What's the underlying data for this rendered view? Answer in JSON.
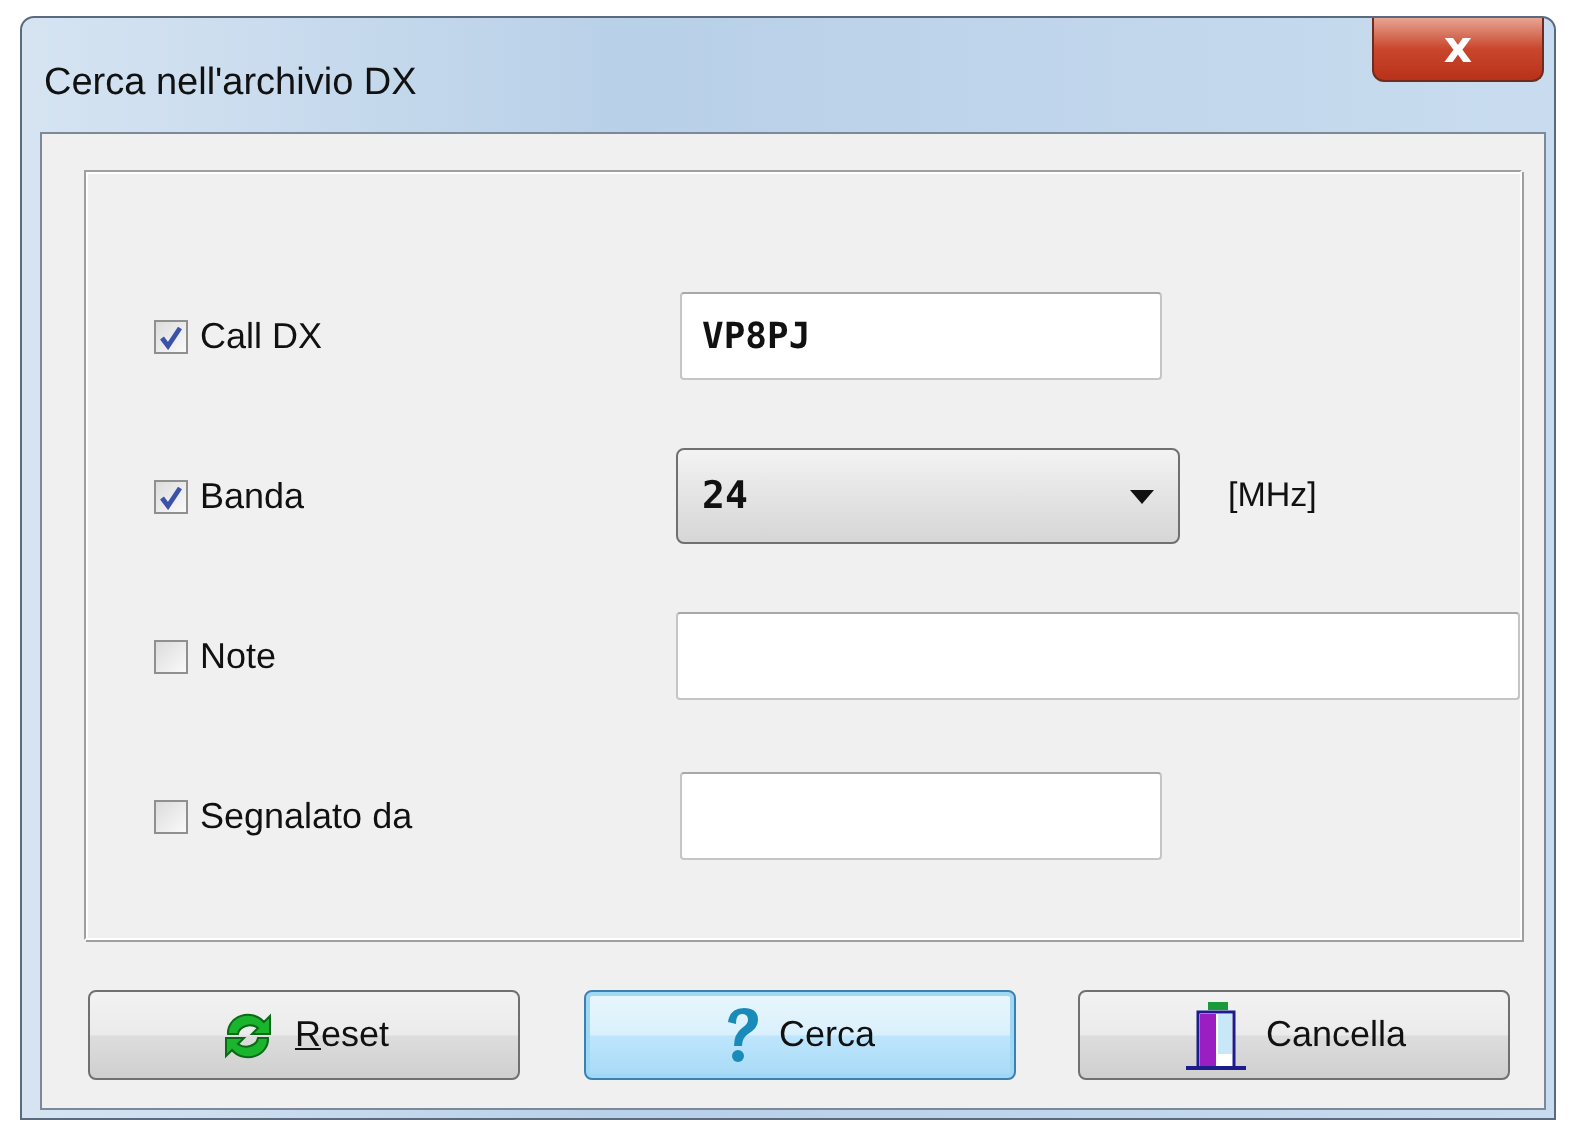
{
  "window": {
    "title": "Cerca nell'archivio DX",
    "close": "x"
  },
  "fields": [
    {
      "label": "Call DX",
      "checked": true,
      "kind": "text",
      "value": "VP8PJ",
      "wide": false
    },
    {
      "label": "Banda",
      "checked": true,
      "kind": "dropdown",
      "value": "24",
      "unit": "[MHz]"
    },
    {
      "label": "Note",
      "checked": false,
      "kind": "text",
      "wide": true
    },
    {
      "label": "Segnalato da",
      "checked": false,
      "kind": "text",
      "wide": false
    }
  ],
  "buttons": [
    {
      "label": "Reset",
      "kind": "reset",
      "default": false,
      "underline_first": true
    },
    {
      "label": "Cerca",
      "kind": "search",
      "default": true,
      "underline_first": false
    },
    {
      "label": "Cancella",
      "kind": "cancel",
      "default": false,
      "underline_first": false
    }
  ]
}
